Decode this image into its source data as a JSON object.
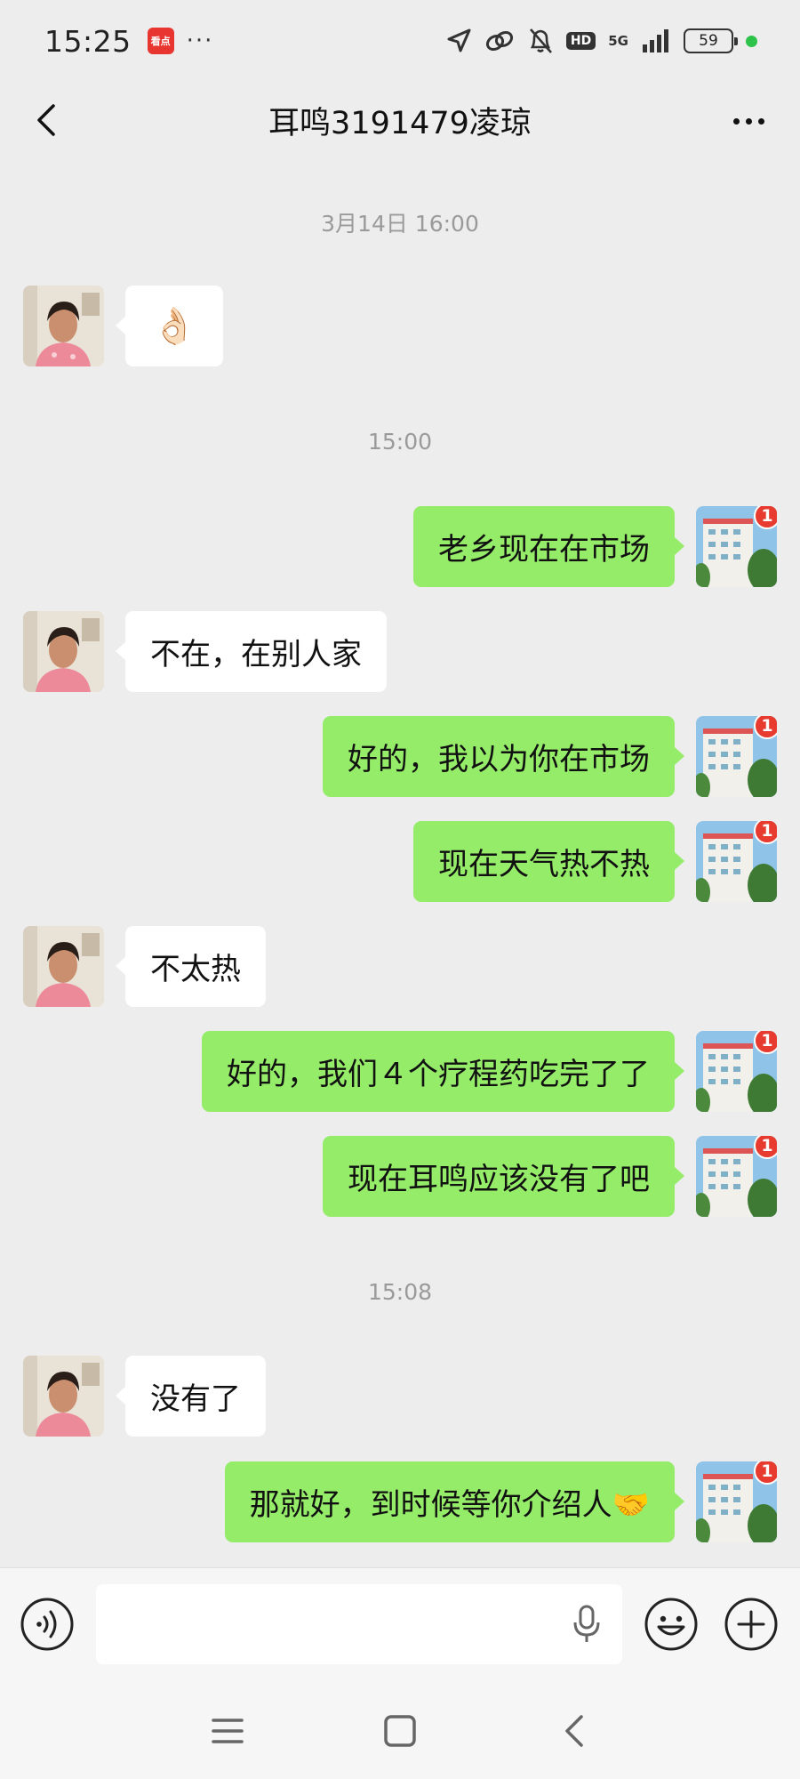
{
  "status_bar": {
    "time": "15:25",
    "app_badge": "看点",
    "dots": "···",
    "hd": "HD",
    "network": "5G",
    "battery": "59"
  },
  "header": {
    "title": "耳鸣3191479凌琼"
  },
  "timestamps": [
    "3月14日 16:00",
    "15:00",
    "15:08"
  ],
  "messages": [
    {
      "side": "in",
      "text": "👌🏻"
    },
    {
      "side": "out",
      "text": "老乡现在在市场",
      "badge": "1"
    },
    {
      "side": "in",
      "text": "不在，在别人家"
    },
    {
      "side": "out",
      "text": "好的，我以为你在市场",
      "badge": "1"
    },
    {
      "side": "out",
      "text": "现在天气热不热",
      "badge": "1"
    },
    {
      "side": "in",
      "text": "不太热"
    },
    {
      "side": "out",
      "text": "好的，我们４个疗程药吃完了了",
      "badge": "1"
    },
    {
      "side": "out",
      "text": "现在耳鸣应该没有了吧",
      "badge": "1"
    },
    {
      "side": "in",
      "text": "没有了"
    },
    {
      "side": "out",
      "text": "那就好，到时候等你介绍人🤝",
      "badge": "1"
    }
  ],
  "input": {
    "value": "",
    "placeholder": ""
  },
  "colors": {
    "incoming_bubble": "#ffffff",
    "outgoing_bubble": "#95ec69",
    "background": "#ededed",
    "badge": "#e63b2e"
  },
  "icons": {
    "back": "back-arrow-icon",
    "more": "more-dots-icon",
    "voice": "voice-input-icon",
    "mic": "microphone-icon",
    "emoji": "emoji-icon",
    "plus": "plus-icon",
    "nav_menu": "menu-icon",
    "nav_home": "home-icon",
    "nav_back": "nav-back-icon"
  }
}
